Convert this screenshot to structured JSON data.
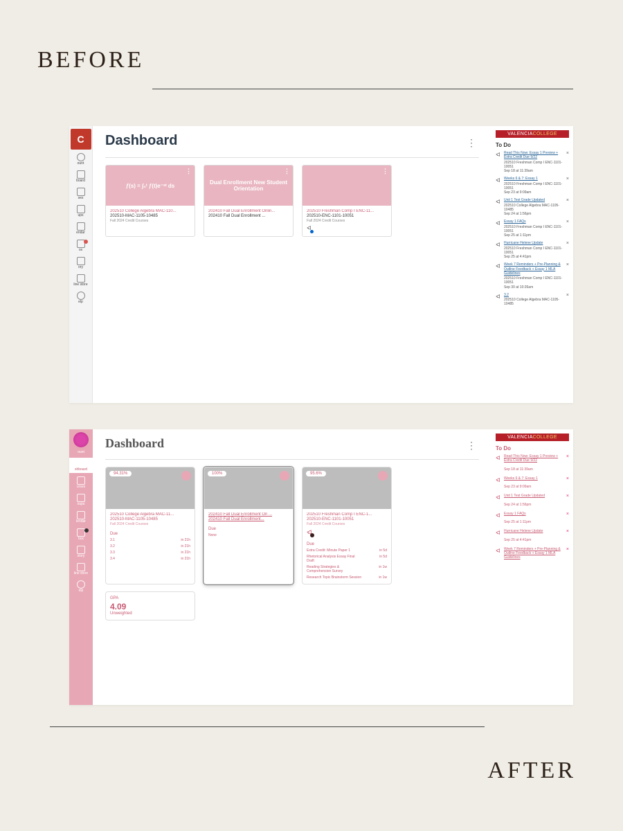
{
  "labels": {
    "before": "BEFORE",
    "after": "AFTER"
  },
  "brand": {
    "part1": "VALENCIA",
    "part2": "COLLEGE"
  },
  "dashboard_title": "Dashboard",
  "todo_title": "To Do",
  "nav": {
    "logo": "C",
    "items": [
      "ount",
      "board",
      "ses",
      "ups",
      "endar",
      "ox",
      "ory",
      "line store",
      "elp"
    ],
    "items2": [
      "ount",
      "shboard",
      "urses",
      "oups",
      "lendar",
      "box",
      "story",
      "line store",
      "elp"
    ]
  },
  "before_cards": [
    {
      "thumb_text": "ƒ(s) = ∫₀ᵗ ƒ(t)e⁻ˢᵗ ds",
      "title": "202510 College Algebra MAC-110...",
      "sub": "202510-MAC-1105-10485",
      "term": "Fall 2024 Credit Courses",
      "annc": false
    },
    {
      "thumb_text": "Dual Enrollment New Student Orientation",
      "title": "202410 Fall Dual Enrollment Onlin...",
      "sub": "202410 Fall Dual Enrollment ...",
      "term": "",
      "annc": false
    },
    {
      "thumb_text": "",
      "title": "202510 Freshman Comp I ENC-11...",
      "sub": "202510-ENC-1101-10051",
      "term": "Fall 2024 Credit Courses",
      "annc": true
    }
  ],
  "before_todo": [
    {
      "title": "Read This Now: Essay 1 Preview + Extra Credit Due 9/22",
      "meta": "202510 Freshman Comp I ENC-1101-10051",
      "time": "Sep 18 at 11:39am"
    },
    {
      "title": "Weeks 6 & 7: Essay 1",
      "meta": "202510 Freshman Comp I ENC-1101-10051",
      "time": "Sep 23 at 9:09am"
    },
    {
      "title": "Unit 1 Test Grade Updated",
      "meta": "202510 College Algebra MAC-1105-10485",
      "time": "Sep 24 at 1:56pm"
    },
    {
      "title": "Essay 1 FAQs",
      "meta": "202510 Freshman Comp I ENC-1101-10051",
      "time": "Sep 25 at 1:11pm"
    },
    {
      "title": "Hurricane Helene Update",
      "meta": "202510 Freshman Comp I ENC-1101-10051",
      "time": "Sep 25 at 4:41pm"
    },
    {
      "title": "Week 7 Reminders + Pre-Planning & Outline Feedback + Essay 1 MLA Guidelines",
      "meta": "202510 Freshman Comp I ENC-1101-10051",
      "time": "Sep 30 at 10:26am"
    },
    {
      "title": "3.2",
      "meta": "202510 College Algebra MAC-1105-10485",
      "time": ""
    }
  ],
  "after_cards": [
    {
      "pct": "94.31%",
      "title": "202510 College Algebra MAC-11...",
      "sub": "202510-MAC-1105-10485",
      "term": "Fall 2024 Credit Courses",
      "selected": false,
      "annc": false,
      "due_header": "Due",
      "due": [
        {
          "l": "3.1",
          "r": "in 21h"
        },
        {
          "l": "3.2",
          "r": "in 21h"
        },
        {
          "l": "3.3",
          "r": "in 21h"
        },
        {
          "l": "3.4",
          "r": "in 21h"
        }
      ]
    },
    {
      "pct": "100%",
      "title": "202410 Fall Dual Enrollment On ...",
      "sub": "202410 Fall Dual Enrollment...",
      "term": "",
      "selected": true,
      "annc": false,
      "due_header": "Due",
      "due": [
        {
          "l": "None",
          "r": ""
        }
      ]
    },
    {
      "pct": "95.6%",
      "title": "202510 Freshman Comp I ENC-1...",
      "sub": "202510-ENC-1101-10051",
      "term": "Fall 2024 Credit Courses",
      "selected": false,
      "annc": true,
      "due_header": "Due",
      "due": [
        {
          "l": "Extra Credit: Minute Paper 1",
          "r": "in 5d"
        },
        {
          "l": "Rhetorical Analysis Essay Final Draft",
          "r": "in 5d"
        },
        {
          "l": "Reading Strategies & Comprehension Survey",
          "r": "in 1w"
        },
        {
          "l": "Research Topic Brainstorm Session",
          "r": "in 1w"
        }
      ]
    }
  ],
  "gpa": {
    "label": "GPA",
    "value": "4.09",
    "weight": "Unweighted"
  },
  "after_todo": [
    {
      "title": "Read This Now: Essay 1 Preview + Extra Credit Due 9/22",
      "time": "Sep 18 at 11:39am"
    },
    {
      "title": "Weeks 6 & 7: Essay 1",
      "time": "Sep 23 at 9:09am"
    },
    {
      "title": "Unit 1 Test Grade Updated",
      "time": "Sep 24 at 1:56pm"
    },
    {
      "title": "Essay 1 FAQs",
      "time": "Sep 25 at 1:11pm"
    },
    {
      "title": "Hurricane Helene Update",
      "time": "Sep 25 at 4:41pm"
    },
    {
      "title": "Week 7 Reminders + Pre-Planning & Outline Feedback + Essay 1 MLA Guidelines",
      "time": ""
    }
  ]
}
